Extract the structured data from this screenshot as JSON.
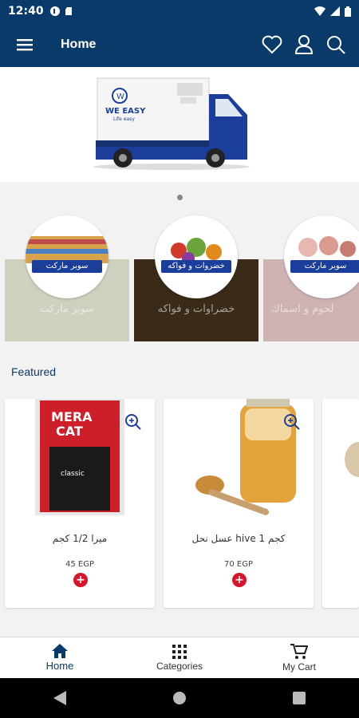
{
  "status_bar": {
    "time": "12:40"
  },
  "app_bar": {
    "title": "Home"
  },
  "categories": [
    {
      "label": "سوبر ماركت",
      "banner": "سوبر ماركت"
    },
    {
      "label": "خضراوات و فواكه",
      "banner": "خضروات و فواكه"
    },
    {
      "label": "لحوم و اسماك",
      "banner": "سوبر ماركت"
    }
  ],
  "banner": {
    "brand": "WE EASY",
    "tagline": "Life easy"
  },
  "featured": {
    "title": "Featured"
  },
  "products": [
    {
      "name": "ميرا  1/2 كجم",
      "price": "45 EGP"
    },
    {
      "name": "عسل نحل hive 1 كجم",
      "price": "70 EGP"
    }
  ],
  "bottom_nav": {
    "items": [
      {
        "label": "Home"
      },
      {
        "label": "Categories"
      },
      {
        "label": "My Cart"
      }
    ]
  },
  "colors": {
    "primary": "#0a3a6a",
    "accent": "#d8152a"
  }
}
